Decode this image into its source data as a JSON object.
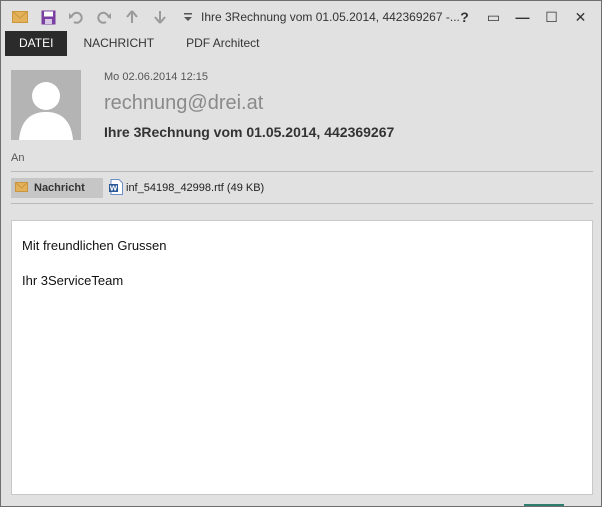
{
  "window": {
    "title": "Ihre 3Rechnung vom 01.05.2014, 442369267 -..."
  },
  "quick_access": [
    {
      "name": "envelope-icon"
    },
    {
      "name": "save-icon"
    },
    {
      "name": "undo-icon"
    },
    {
      "name": "redo-icon"
    },
    {
      "name": "up-arrow-icon"
    },
    {
      "name": "down-arrow-icon"
    },
    {
      "name": "customize-qat-icon"
    }
  ],
  "controls": {
    "help": "?",
    "restore": "▭",
    "minimize": "—",
    "maximize": "☐",
    "close": "✕"
  },
  "tabs": [
    {
      "label": "DATEI",
      "active": true
    },
    {
      "label": "NACHRICHT",
      "active": false
    },
    {
      "label": "PDF Architect",
      "active": false
    }
  ],
  "message": {
    "date": "Mo 02.06.2014 12:15",
    "sender": "rechnung@drei.at",
    "subject": "Ihre 3Rechnung vom 01.05.2014, 442369267",
    "to_label": "An",
    "message_chip": "Nachricht",
    "attachment": "inf_54198_42998.rtf (49 KB)"
  },
  "body": {
    "line1": "Mit freundlichen Grussen",
    "line2": "Ihr 3ServiceTeam"
  },
  "colors": {
    "chrome": "#e1e1e1",
    "active_tab": "#2b2b2b",
    "save_icon": "#7a3fa0",
    "envelope": "#e3b15a"
  }
}
